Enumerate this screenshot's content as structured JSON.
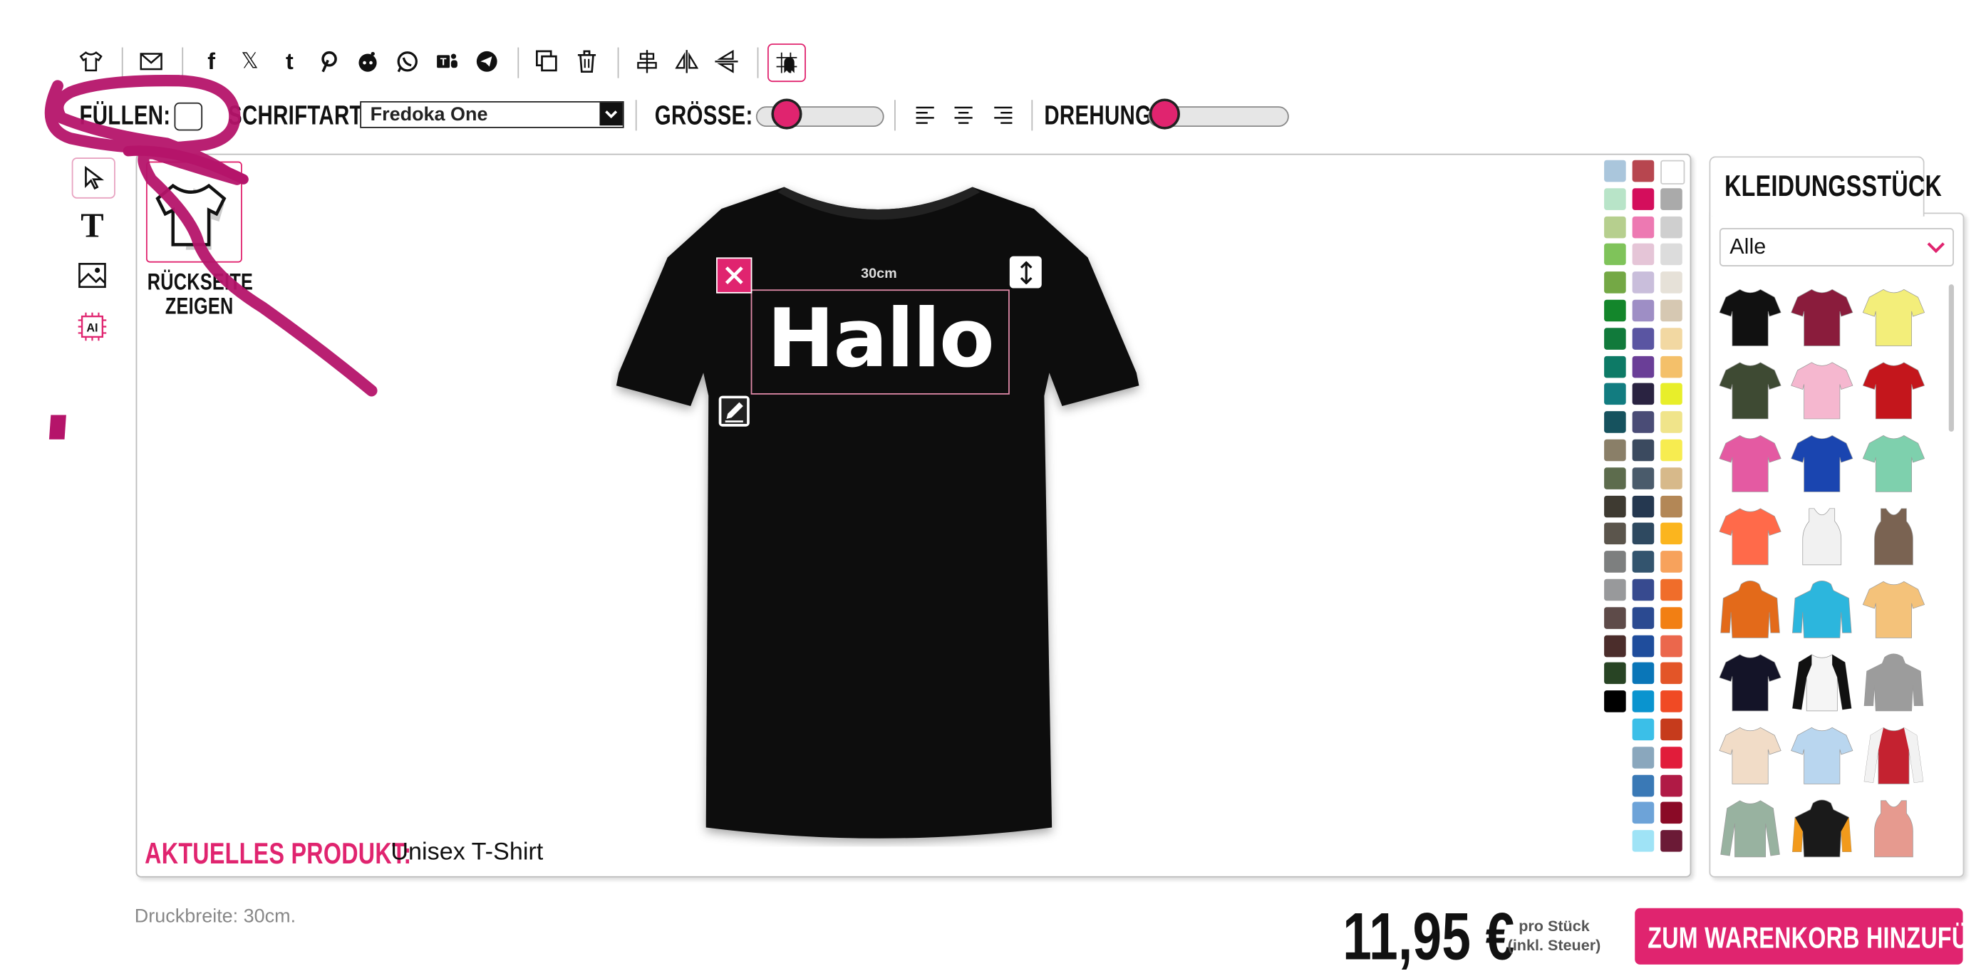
{
  "toolbar": {
    "icons": [
      "tshirt-icon",
      "mail-icon",
      "facebook-icon",
      "x-icon",
      "tumblr-icon",
      "pinterest-icon",
      "reddit-icon",
      "whatsapp-icon",
      "teams-icon",
      "telegram-icon",
      "duplicate-icon",
      "trash-icon",
      "align-center-icon",
      "flip-horizontal-icon",
      "flip-vertical-icon",
      "grid-ghost-icon"
    ],
    "fill_label": "FÜLLEN:",
    "font_label": "SCHRIFTART:",
    "font_value": "Fredoka One",
    "size_label": "GRÖSSE:",
    "size_value": 0.15,
    "rotation_label": "DREHUNG:",
    "rotation_value": 0.0
  },
  "left_tools": [
    "pointer-icon",
    "text-icon",
    "image-icon",
    "ai-icon"
  ],
  "back_side": {
    "line1": "RÜCKSEITE",
    "line2": "ZEIGEN"
  },
  "canvas": {
    "text": "Hallo",
    "measure": "30cm",
    "current_product_label": "AKTUELLES PRODUKT:",
    "current_product_value": "Unisex T-Shirt"
  },
  "colors": {
    "col1": [
      "#aac6dc",
      "#b8e4c8",
      "#b6cf8e",
      "#7fc35a",
      "#74a845",
      "#13862b",
      "#117a3b",
      "#0d7a66",
      "#127c80",
      "#16525e",
      "#8a7f68",
      "#5d6c4d",
      "#3e3a31",
      "#5b554c",
      "#7d7f7f",
      "#98999b",
      "#5e4b49",
      "#4b2d2b",
      "#284424",
      "#000000"
    ],
    "col2": [
      "#b7464f",
      "#d40e5c",
      "#ed79b2",
      "#e5c5d7",
      "#c9bedb",
      "#9e8ec5",
      "#5a55a2",
      "#6a3e97",
      "#2a2341",
      "#4a4c76",
      "#3b4a5f",
      "#4a5b6b",
      "#253850",
      "#2e4960",
      "#33546e",
      "#374a8f",
      "#2b4a91",
      "#1f4d9c",
      "#0a76b8",
      "#0a94cf",
      "#3bbfe8",
      "#8aa7bd",
      "#3a79b6",
      "#6da3d8",
      "#9fe3f6"
    ],
    "col3": [
      "#ffffff",
      "#aaaaaa",
      "#cfcfcf",
      "#dcdcdc",
      "#e6e1d8",
      "#d6c8b2",
      "#f2d8a2",
      "#f4c06a",
      "#e8ee2a",
      "#f0e48a",
      "#f7ec50",
      "#d7b98a",
      "#b38756",
      "#fbb51e",
      "#f7a25c",
      "#f06d2a",
      "#f27f13",
      "#eb674c",
      "#e35528",
      "#f04a24",
      "#c63b1c",
      "#e11c3a",
      "#b01a45",
      "#8a0a26",
      "#6b1a36"
    ],
    "accent": "#e0246f"
  },
  "garment_panel": {
    "tab_label": "KLEIDUNGSSTÜCK",
    "filter_value": "Alle",
    "items": [
      {
        "name": "black-tshirt",
        "color": "#111111"
      },
      {
        "name": "burgundy-tshirt",
        "color": "#8a1c3c"
      },
      {
        "name": "yellow-tshirt",
        "color": "#f3ee7a"
      },
      {
        "name": "olive-tshirt",
        "color": "#3e4a33"
      },
      {
        "name": "light-pink-tshirt",
        "color": "#f5b7cf"
      },
      {
        "name": "red-tshirt",
        "color": "#c4161c"
      },
      {
        "name": "pink-tshirt",
        "color": "#e45aa2"
      },
      {
        "name": "royal-blue-tshirt",
        "color": "#1a45b0"
      },
      {
        "name": "mint-tshirt",
        "color": "#7ed0ad"
      },
      {
        "name": "coral-tshirt",
        "color": "#ff6a4a"
      },
      {
        "name": "white-tank",
        "color": "#f1f1f1"
      },
      {
        "name": "brown-tank",
        "color": "#7a6352"
      },
      {
        "name": "orange-hoodie",
        "color": "#e36a1a"
      },
      {
        "name": "turquoise-hoodie",
        "color": "#2cb6dd"
      },
      {
        "name": "tie-dye-tshirt",
        "color": "#f4c27a"
      },
      {
        "name": "black-tshirt-2",
        "color": "#141428"
      },
      {
        "name": "raglan-tshirt",
        "color": "#f5f5f5"
      },
      {
        "name": "grey-hoodie",
        "color": "#9c9c9c"
      },
      {
        "name": "beige-tshirt",
        "color": "#f1dcc7"
      },
      {
        "name": "gradient-tshirt",
        "color": "#b9d6ef"
      },
      {
        "name": "college-jacket",
        "color": "#c42230"
      },
      {
        "name": "sage-longsleeve",
        "color": "#98b2a0"
      },
      {
        "name": "black-orange-hoodie",
        "color": "#1a1a1a"
      },
      {
        "name": "rose-tank",
        "color": "#e69a8f"
      }
    ]
  },
  "footer": {
    "print_width": "Druckbreite: 30cm.",
    "price": "11,95 €",
    "per_piece": "pro Stück",
    "tax_note": "(inkl. Steuer)",
    "cart_button": "ZUM WARENKORB HINZUFÜGEN"
  }
}
